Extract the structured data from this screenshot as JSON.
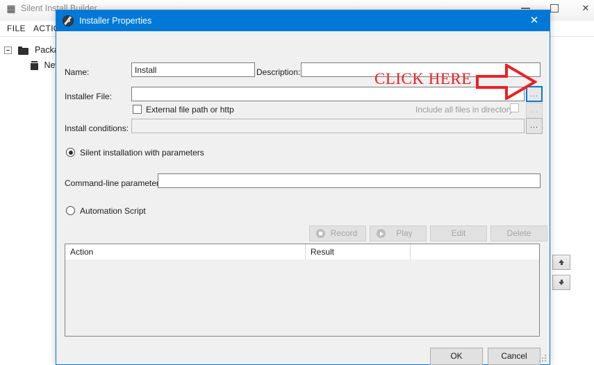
{
  "main_window": {
    "title": "Silent Install Builder",
    "title_icon": "package-icon",
    "controls": {
      "minimize": "minimize-button",
      "maximize": "maximize-button",
      "close": "✕"
    },
    "menu": [
      {
        "label": "FILE",
        "name": "menu-file"
      },
      {
        "label": "ACTIONS",
        "name": "menu-actions"
      }
    ],
    "tree": {
      "root_label": "Package",
      "child_label": "New"
    },
    "side_buttons": [
      {
        "name": "move-up-button",
        "icon": "arrow-up-icon"
      },
      {
        "name": "move-down-button",
        "icon": "arrow-down-icon"
      }
    ]
  },
  "dialog": {
    "title": "Installer Properties",
    "icon": "installer-disc-icon",
    "close_label": "✕",
    "fields": {
      "name_label": "Name:",
      "name_value": "Install",
      "description_label": "Description:",
      "description_value": "",
      "installer_file_label": "Installer File:",
      "installer_file_value": "",
      "external_checkbox_label": "External file path or http",
      "include_all_label": "Include all files in directory",
      "install_conditions_label": "Install conditions:",
      "install_conditions_value": "",
      "browse_label": "..."
    },
    "modes": {
      "silent_label": "Silent installation with parameters",
      "silent_selected": true,
      "params_label": "Command-line parameters:",
      "params_value": "",
      "automation_label": "Automation Script",
      "automation_selected": false
    },
    "toolbar": [
      {
        "label": "Record",
        "name": "record-button",
        "icon": "record-icon",
        "enabled": false
      },
      {
        "label": "Play",
        "name": "play-button",
        "icon": "play-icon",
        "enabled": false
      },
      {
        "label": "Edit",
        "name": "edit-button",
        "icon": "",
        "enabled": false
      },
      {
        "label": "Delete",
        "name": "delete-button",
        "icon": "",
        "enabled": false
      }
    ],
    "grid": {
      "columns": [
        "Action",
        "Result",
        ""
      ],
      "rows": []
    },
    "footer": {
      "ok_label": "OK",
      "cancel_label": "Cancel"
    }
  },
  "annotation": {
    "text": "CLICK HERE",
    "color": "#ec2024",
    "arrow": "right-arrow"
  },
  "colors": {
    "accent": "#0078d7",
    "dialog_bg": "#f0f0f0",
    "annotation_red": "#ec2024"
  }
}
